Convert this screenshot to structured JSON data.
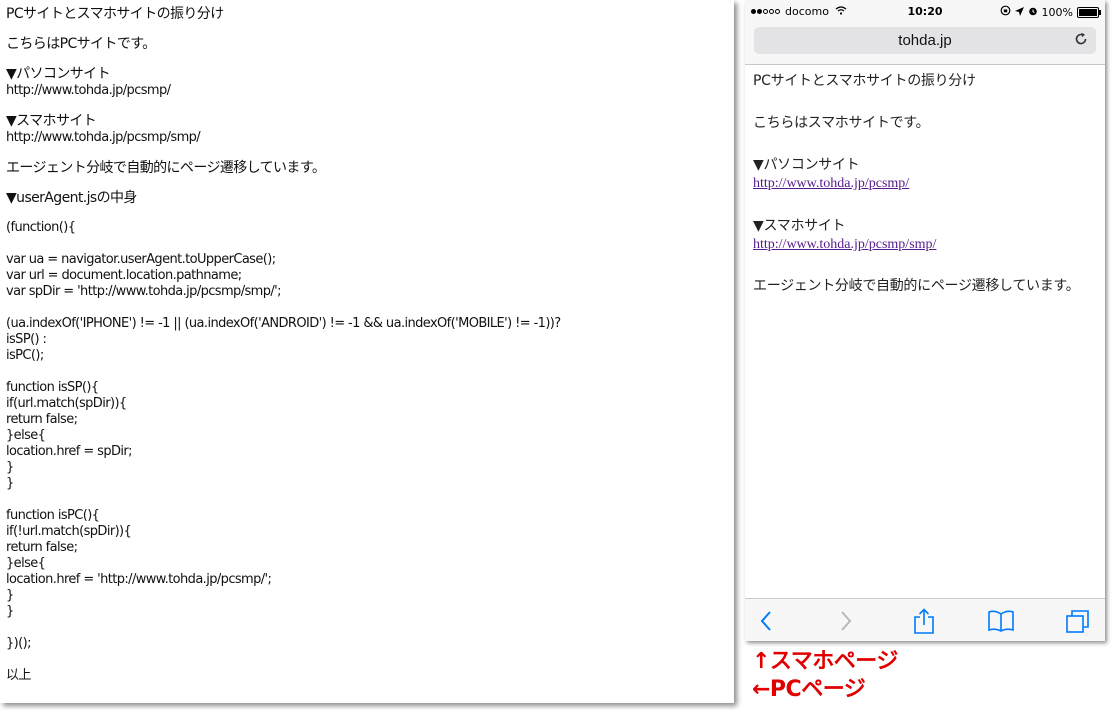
{
  "pc_page": {
    "title": "PCサイトとスマホサイトの振り分け",
    "intro": "こちらはPCサイトです。",
    "pc_heading": "▼パソコンサイト",
    "pc_url": "http://www.tohda.jp/pcsmp/",
    "sp_heading": "▼スマホサイト",
    "sp_url": "http://www.tohda.jp/pcsmp/smp/",
    "description": "エージェント分岐で自動的にページ遷移しています。",
    "code_heading": "▼userAgent.jsの中身",
    "code_blocks": [
      [
        "(function(){"
      ],
      [
        "var ua = navigator.userAgent.toUpperCase();",
        "var url = document.location.pathname;",
        "var spDir = 'http://www.tohda.jp/pcsmp/smp/';"
      ],
      [
        "(ua.indexOf('IPHONE') != -1 || (ua.indexOf('ANDROID') != -1 && ua.indexOf('MOBILE') != -1))?",
        "isSP() :",
        "isPC();"
      ],
      [
        "function isSP(){",
        "if(url.match(spDir)){",
        "return false;",
        "}else{",
        "location.href = spDir;",
        "}",
        "}"
      ],
      [
        "function isPC(){",
        "if(!url.match(spDir)){",
        "return false;",
        "}else{",
        "location.href = 'http://www.tohda.jp/pcsmp/';",
        "}",
        "}"
      ],
      [
        "})();"
      ]
    ],
    "closing": "以上"
  },
  "phone": {
    "status": {
      "carrier": "docomo",
      "time": "10:20",
      "battery": "100%"
    },
    "address": "tohda.jp",
    "content": {
      "title": "PCサイトとスマホサイトの振り分け",
      "intro": "こちらはスマホサイトです。",
      "pc_heading": "▼パソコンサイト",
      "pc_url": "http://www.tohda.jp/pcsmp/",
      "sp_heading": "▼スマホサイト",
      "sp_url": "http://www.tohda.jp/pcsmp/smp/",
      "description": "エージェント分岐で自動的にページ遷移しています。"
    },
    "icons": {
      "back": "back-chevron-icon",
      "forward": "forward-chevron-icon",
      "share": "share-icon",
      "bookmarks": "bookmarks-icon",
      "tabs": "tabs-icon",
      "reload": "reload-icon"
    },
    "accent_color": "#007aff",
    "link_color": "#551a8b"
  },
  "annotation": {
    "sp_label": "↑スマホページ",
    "pc_label": "←PCページ",
    "color": "#e00000"
  }
}
